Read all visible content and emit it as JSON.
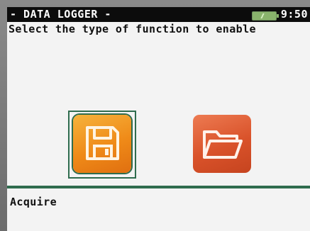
{
  "header": {
    "title": "- DATA LOGGER -",
    "time": "9:50",
    "battery_color": "#89b36c"
  },
  "prompt": "Select the type of function to enable",
  "functions": [
    {
      "icon": "floppy-disk-icon",
      "color": "#ef8a18",
      "selected": true
    },
    {
      "icon": "folder-icon",
      "color": "#d9522a",
      "selected": false
    }
  ],
  "status": {
    "label": "Acquire"
  },
  "colors": {
    "accent": "#2f6c4e",
    "header_bg": "#0c0c0c",
    "screen_bg": "#f3f3f3"
  }
}
